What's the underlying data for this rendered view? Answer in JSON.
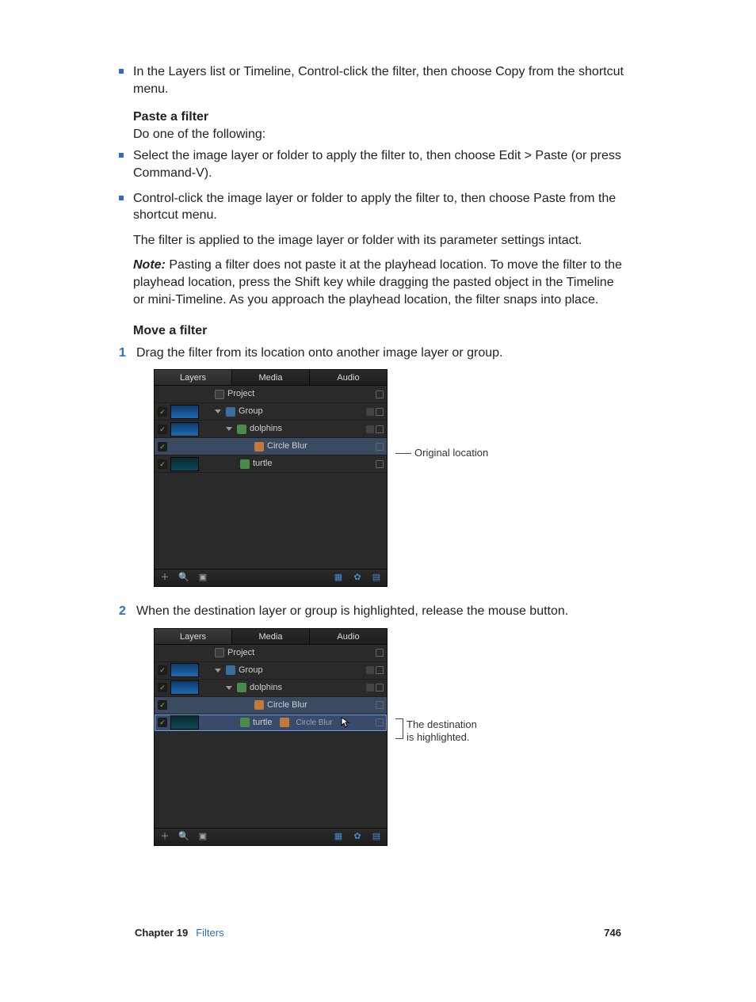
{
  "heading_paste": "Paste a filter",
  "heading_move": "Move a filter",
  "bullets_top": [
    "In the Layers list or Timeline, Control-click the filter, then choose Copy from the shortcut menu."
  ],
  "paste_intro": "Do one of the following:",
  "bullets_paste": [
    "Select the image layer or folder to apply the filter to, then choose Edit > Paste (or press Command-V).",
    "Control-click the image layer or folder to apply the filter to, then choose Paste from the shortcut menu."
  ],
  "para_applied": "The filter is applied to the image layer or folder with its parameter settings intact.",
  "note_label": "Note:",
  "para_note": "Pasting a filter does not paste it at the playhead location. To move the filter to the playhead location, press the Shift key while dragging the pasted object in the Timeline or mini-Timeline. As you approach the playhead location, the filter snaps into place.",
  "steps": [
    "Drag the filter from its location onto another image layer or group.",
    "When the destination layer or group is highlighted, release the mouse button."
  ],
  "callout1": "Original location",
  "callout2a": "The destination",
  "callout2b": "is highlighted.",
  "tabs": {
    "layers": "Layers",
    "media": "Media",
    "audio": "Audio"
  },
  "panel1_rows": {
    "project": "Project",
    "group": "Group",
    "dolphins": "dolphins",
    "circleblur": "Circle Blur",
    "turtle": "turtle"
  },
  "panel2_rows": {
    "project": "Project",
    "group": "Group",
    "dolphins": "dolphins",
    "circleblur": "Circle Blur",
    "turtle": "turtle",
    "ghost": "Circle Blur"
  },
  "footer": {
    "chapter": "Chapter 19",
    "name": "Filters",
    "page": "746"
  }
}
